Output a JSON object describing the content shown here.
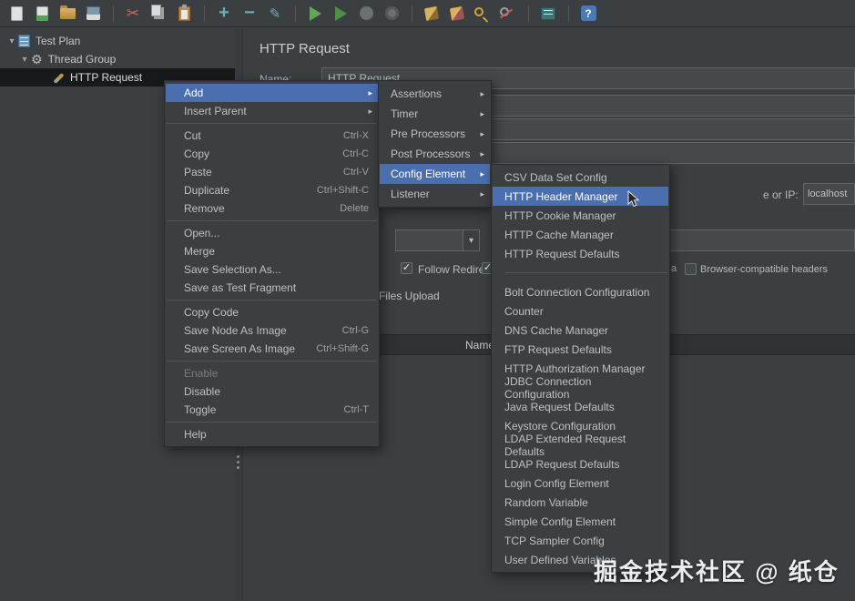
{
  "colors": {
    "selection": "#4b6eaf",
    "menu_bg": "#3c3f41",
    "field_bg": "#45494a",
    "panel_bg": "#3c3f41",
    "tree_selected_bg": "#17191b"
  },
  "toolbar": {
    "icons": [
      {
        "name": "new-file-icon",
        "cls": "ic-new",
        "glyph": ""
      },
      {
        "name": "templates-icon",
        "cls": "ic-templates",
        "glyph": ""
      },
      {
        "name": "open-icon",
        "cls": "ic-open",
        "glyph": ""
      },
      {
        "name": "save-icon",
        "cls": "ic-save",
        "glyph": ""
      },
      {
        "name": "cut-icon",
        "cls": "ic-cut grp",
        "glyph": "✂"
      },
      {
        "name": "copy-icon",
        "cls": "ic-copy",
        "glyph": ""
      },
      {
        "name": "paste-icon",
        "cls": "ic-paste",
        "glyph": ""
      },
      {
        "name": "add-icon",
        "cls": "ic-plus grp",
        "glyph": "+"
      },
      {
        "name": "remove-icon",
        "cls": "ic-minus",
        "glyph": "−"
      },
      {
        "name": "edit-icon",
        "cls": "ic-pencil",
        "glyph": "✎"
      },
      {
        "name": "start-icon",
        "cls": "ic-play grp",
        "glyph": ""
      },
      {
        "name": "start-no-pauses-icon",
        "cls": "ic-play2",
        "glyph": ""
      },
      {
        "name": "stop-icon",
        "cls": "ic-stop",
        "glyph": ""
      },
      {
        "name": "shutdown-icon",
        "cls": "ic-shutdown",
        "glyph": ""
      },
      {
        "name": "clear-icon",
        "cls": "ic-clear grp",
        "glyph": ""
      },
      {
        "name": "clear-all-icon",
        "cls": "ic-clear-all",
        "glyph": ""
      },
      {
        "name": "search-icon",
        "cls": "ic-search",
        "glyph": ""
      },
      {
        "name": "reset-search-icon",
        "cls": "ic-reset-search",
        "glyph": ""
      },
      {
        "name": "function-helper-icon",
        "cls": "ic-function grp",
        "glyph": ""
      },
      {
        "name": "help-icon",
        "cls": "ic-help grp",
        "glyph": "?"
      }
    ]
  },
  "tree": {
    "items": [
      {
        "label": "Test Plan"
      },
      {
        "label": "Thread Group"
      },
      {
        "label": "HTTP Request"
      }
    ]
  },
  "main": {
    "title": "HTTP Request",
    "name_label": "Name:",
    "name_value": "HTTP Request",
    "server_label_partial": "e or IP:",
    "server_value": "localhost",
    "follow_redirects_label": "Follow Redirects",
    "multipart_tail": "a",
    "browser_headers_label": "Browser-compatible headers",
    "files_upload_tab": "Files Upload",
    "table_header_name": "Name"
  },
  "context_menu": {
    "items": [
      {
        "name": "menu-item-add",
        "label": "Add",
        "shortcut": "",
        "arrow": "▸",
        "cls": "highlighted",
        "inter": "true"
      },
      {
        "name": "menu-item-insert-parent",
        "label": "Insert Parent",
        "shortcut": "",
        "arrow": "▸",
        "cls": "",
        "inter": "true"
      },
      {
        "name": "menu-separator",
        "label": "",
        "shortcut": "",
        "arrow": "",
        "cls": "sep-item",
        "inter": "false"
      },
      {
        "name": "menu-item-cut",
        "label": "Cut",
        "shortcut": "Ctrl-X",
        "arrow": "",
        "cls": "",
        "inter": "true"
      },
      {
        "name": "menu-item-copy",
        "label": "Copy",
        "shortcut": "Ctrl-C",
        "arrow": "",
        "cls": "",
        "inter": "true"
      },
      {
        "name": "menu-item-paste",
        "label": "Paste",
        "shortcut": "Ctrl-V",
        "arrow": "",
        "cls": "",
        "inter": "true"
      },
      {
        "name": "menu-item-duplicate",
        "label": "Duplicate",
        "shortcut": "Ctrl+Shift-C",
        "arrow": "",
        "cls": "",
        "inter": "true"
      },
      {
        "name": "menu-item-remove",
        "label": "Remove",
        "shortcut": "Delete",
        "arrow": "",
        "cls": "",
        "inter": "true"
      },
      {
        "name": "menu-separator",
        "label": "",
        "shortcut": "",
        "arrow": "",
        "cls": "sep-item",
        "inter": "false"
      },
      {
        "name": "menu-item-open",
        "label": "Open...",
        "shortcut": "",
        "arrow": "",
        "cls": "",
        "inter": "true"
      },
      {
        "name": "menu-item-merge",
        "label": "Merge",
        "shortcut": "",
        "arrow": "",
        "cls": "",
        "inter": "true"
      },
      {
        "name": "menu-item-save-selection-as",
        "label": "Save Selection As...",
        "shortcut": "",
        "arrow": "",
        "cls": "",
        "inter": "true"
      },
      {
        "name": "menu-item-save-as-test-fragment",
        "label": "Save as Test Fragment",
        "shortcut": "",
        "arrow": "",
        "cls": "",
        "inter": "true"
      },
      {
        "name": "menu-separator",
        "label": "",
        "shortcut": "",
        "arrow": "",
        "cls": "sep-item",
        "inter": "false"
      },
      {
        "name": "menu-item-copy-code",
        "label": "Copy Code",
        "shortcut": "",
        "arrow": "",
        "cls": "",
        "inter": "true"
      },
      {
        "name": "menu-item-save-node-as-image",
        "label": "Save Node As Image",
        "shortcut": "Ctrl-G",
        "arrow": "",
        "cls": "",
        "inter": "true"
      },
      {
        "name": "menu-item-save-screen-as-image",
        "label": "Save Screen As Image",
        "shortcut": "Ctrl+Shift-G",
        "arrow": "",
        "cls": "",
        "inter": "true"
      },
      {
        "name": "menu-separator",
        "label": "",
        "shortcut": "",
        "arrow": "",
        "cls": "sep-item",
        "inter": "false"
      },
      {
        "name": "menu-item-enable",
        "label": "Enable",
        "shortcut": "",
        "arrow": "",
        "cls": "disabled",
        "inter": "false"
      },
      {
        "name": "menu-item-disable",
        "label": "Disable",
        "shortcut": "",
        "arrow": "",
        "cls": "",
        "inter": "true"
      },
      {
        "name": "menu-item-toggle",
        "label": "Toggle",
        "shortcut": "Ctrl-T",
        "arrow": "",
        "cls": "",
        "inter": "true"
      },
      {
        "name": "menu-separator",
        "label": "",
        "shortcut": "",
        "arrow": "",
        "cls": "sep-item",
        "inter": "false"
      },
      {
        "name": "menu-item-help",
        "label": "Help",
        "shortcut": "",
        "arrow": "",
        "cls": "",
        "inter": "true"
      }
    ]
  },
  "add_submenu": {
    "items": [
      {
        "name": "submenu-item-assertions",
        "label": "Assertions",
        "shortcut": "",
        "arrow": "▸",
        "cls": "",
        "inter": "true"
      },
      {
        "name": "submenu-item-timer",
        "label": "Timer",
        "shortcut": "",
        "arrow": "▸",
        "cls": "",
        "inter": "true"
      },
      {
        "name": "submenu-item-pre-processors",
        "label": "Pre Processors",
        "shortcut": "",
        "arrow": "▸",
        "cls": "",
        "inter": "true"
      },
      {
        "name": "submenu-item-post-processors",
        "label": "Post Processors",
        "shortcut": "",
        "arrow": "▸",
        "cls": "",
        "inter": "true"
      },
      {
        "name": "submenu-item-config-element",
        "label": "Config Element",
        "shortcut": "",
        "arrow": "▸",
        "cls": "highlighted",
        "inter": "true"
      },
      {
        "name": "submenu-item-listener",
        "label": "Listener",
        "shortcut": "",
        "arrow": "▸",
        "cls": "",
        "inter": "true"
      }
    ]
  },
  "config_submenu": {
    "items": [
      {
        "name": "config-item-csv-data-set-config",
        "label": "CSV Data Set Config",
        "shortcut": "",
        "arrow": "",
        "cls": "",
        "inter": "true"
      },
      {
        "name": "config-item-http-header-manager",
        "label": "HTTP Header Manager",
        "shortcut": "",
        "arrow": "",
        "cls": "highlighted",
        "inter": "true"
      },
      {
        "name": "config-item-http-cookie-manager",
        "label": "HTTP Cookie Manager",
        "shortcut": "",
        "arrow": "",
        "cls": "",
        "inter": "true"
      },
      {
        "name": "config-item-http-cache-manager",
        "label": "HTTP Cache Manager",
        "shortcut": "",
        "arrow": "",
        "cls": "",
        "inter": "true"
      },
      {
        "name": "config-item-http-request-defaults",
        "label": "HTTP Request Defaults",
        "shortcut": "",
        "arrow": "",
        "cls": "",
        "inter": "true"
      },
      {
        "name": "menu-separator",
        "label": "",
        "shortcut": "",
        "arrow": "",
        "cls": "sep-item",
        "inter": "false"
      },
      {
        "name": "config-item-bolt-connection-configuration",
        "label": "Bolt Connection Configuration",
        "shortcut": "",
        "arrow": "",
        "cls": "",
        "inter": "true"
      },
      {
        "name": "config-item-counter",
        "label": "Counter",
        "shortcut": "",
        "arrow": "",
        "cls": "",
        "inter": "true"
      },
      {
        "name": "config-item-dns-cache-manager",
        "label": "DNS Cache Manager",
        "shortcut": "",
        "arrow": "",
        "cls": "",
        "inter": "true"
      },
      {
        "name": "config-item-ftp-request-defaults",
        "label": "FTP Request Defaults",
        "shortcut": "",
        "arrow": "",
        "cls": "",
        "inter": "true"
      },
      {
        "name": "config-item-http-authorization-manager",
        "label": "HTTP Authorization Manager",
        "shortcut": "",
        "arrow": "",
        "cls": "",
        "inter": "true"
      },
      {
        "name": "config-item-jdbc-connection-configuration",
        "label": "JDBC Connection Configuration",
        "shortcut": "",
        "arrow": "",
        "cls": "",
        "inter": "true"
      },
      {
        "name": "config-item-java-request-defaults",
        "label": "Java Request Defaults",
        "shortcut": "",
        "arrow": "",
        "cls": "",
        "inter": "true"
      },
      {
        "name": "config-item-keystore-configuration",
        "label": "Keystore Configuration",
        "shortcut": "",
        "arrow": "",
        "cls": "",
        "inter": "true"
      },
      {
        "name": "config-item-ldap-extended-request-defaults",
        "label": "LDAP Extended Request Defaults",
        "shortcut": "",
        "arrow": "",
        "cls": "",
        "inter": "true"
      },
      {
        "name": "config-item-ldap-request-defaults",
        "label": "LDAP Request Defaults",
        "shortcut": "",
        "arrow": "",
        "cls": "",
        "inter": "true"
      },
      {
        "name": "config-item-login-config-element",
        "label": "Login Config Element",
        "shortcut": "",
        "arrow": "",
        "cls": "",
        "inter": "true"
      },
      {
        "name": "config-item-random-variable",
        "label": "Random Variable",
        "shortcut": "",
        "arrow": "",
        "cls": "",
        "inter": "true"
      },
      {
        "name": "config-item-simple-config-element",
        "label": "Simple Config Element",
        "shortcut": "",
        "arrow": "",
        "cls": "",
        "inter": "true"
      },
      {
        "name": "config-item-tcp-sampler-config",
        "label": "TCP Sampler Config",
        "shortcut": "",
        "arrow": "",
        "cls": "",
        "inter": "true"
      },
      {
        "name": "config-item-user-defined-variables",
        "label": "User Defined Variables",
        "shortcut": "",
        "arrow": "",
        "cls": "",
        "inter": "true"
      }
    ]
  },
  "watermark": "掘金技术社区 @ 纸仓"
}
